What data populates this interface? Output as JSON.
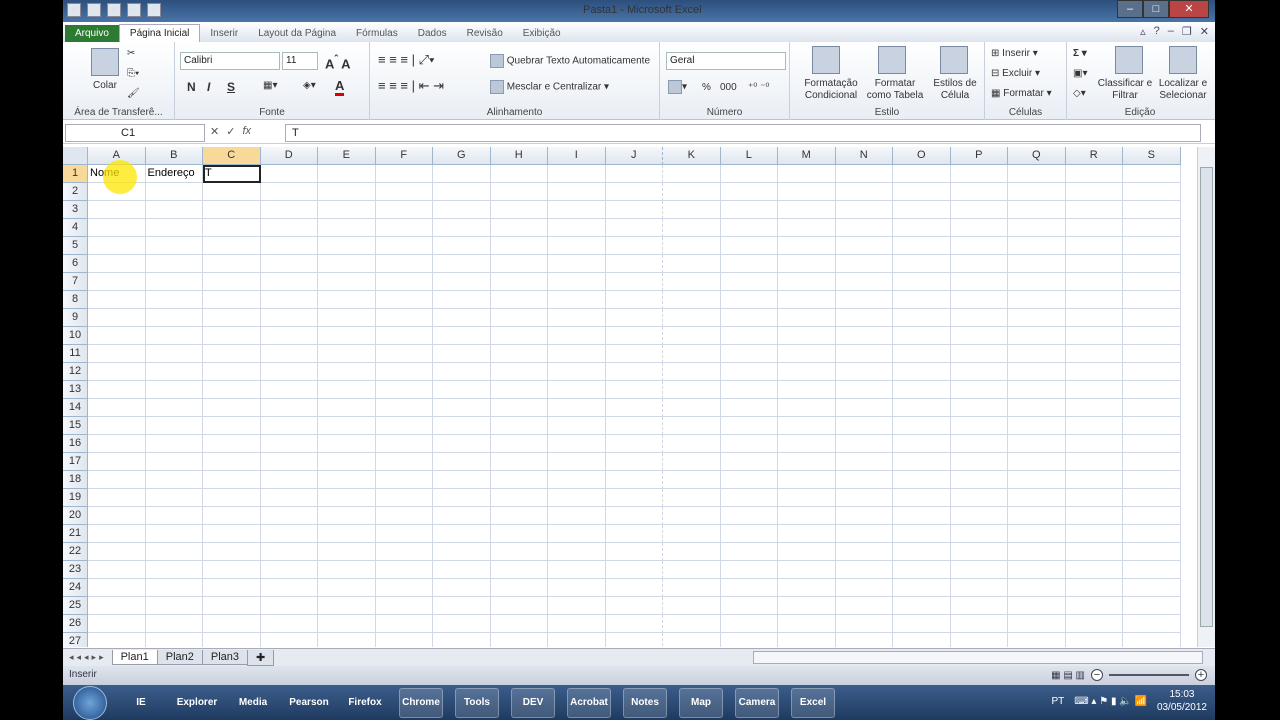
{
  "window": {
    "title": "Pasta1  -  Microsoft Excel"
  },
  "tabs": [
    {
      "label": "Arquivo"
    },
    {
      "label": "Página Inicial"
    },
    {
      "label": "Inserir"
    },
    {
      "label": "Layout da Página"
    },
    {
      "label": "Fórmulas"
    },
    {
      "label": "Dados"
    },
    {
      "label": "Revisão"
    },
    {
      "label": "Exibição"
    }
  ],
  "ribbon": {
    "clipboard": {
      "paste": "Colar",
      "group": "Área de Transferê..."
    },
    "font": {
      "name": "Calibri",
      "size": "11",
      "bold": "N",
      "italic": "I",
      "underline": "S",
      "group": "Fonte"
    },
    "alignment": {
      "wrap": "Quebrar Texto Automaticamente",
      "merge": "Mesclar e Centralizar",
      "group": "Alinhamento"
    },
    "number": {
      "format": "Geral",
      "percent": "%",
      "thousands": "000",
      "group": "Número"
    },
    "styles": {
      "conditional": "Formatação Condicional",
      "table": "Formatar como Tabela",
      "cell": "Estilos de Célula",
      "group": "Estilo"
    },
    "cells": {
      "insert": "Inserir",
      "delete": "Excluir",
      "format": "Formatar",
      "group": "Células"
    },
    "editing": {
      "sort": "Classificar e Filtrar",
      "find": "Localizar e Selecionar",
      "group": "Edição"
    }
  },
  "formula_bar": {
    "name_box": "C1",
    "value": "T"
  },
  "sheet": {
    "columns": [
      "A",
      "B",
      "C",
      "D",
      "E",
      "F",
      "G",
      "H",
      "I",
      "J",
      "K",
      "L",
      "M",
      "N",
      "O",
      "P",
      "Q",
      "R",
      "S"
    ],
    "row_count": 27,
    "active_cell": "C1",
    "cells": {
      "A1": "Nome",
      "B1": "Endereço",
      "C1": "T"
    }
  },
  "sheet_tabs": [
    {
      "label": "Plan1",
      "active": true
    },
    {
      "label": "Plan2"
    },
    {
      "label": "Plan3"
    }
  ],
  "status": {
    "mode": "Inserir"
  },
  "taskbar": {
    "apps": [
      "IE",
      "Explorer",
      "Media",
      "Pearson",
      "Firefox",
      "Chrome",
      "Tools",
      "DEV",
      "Acrobat",
      "Notes",
      "Map",
      "Camera",
      "Excel"
    ],
    "lang": "PT",
    "time": "15:03",
    "date": "03/05/2012"
  }
}
